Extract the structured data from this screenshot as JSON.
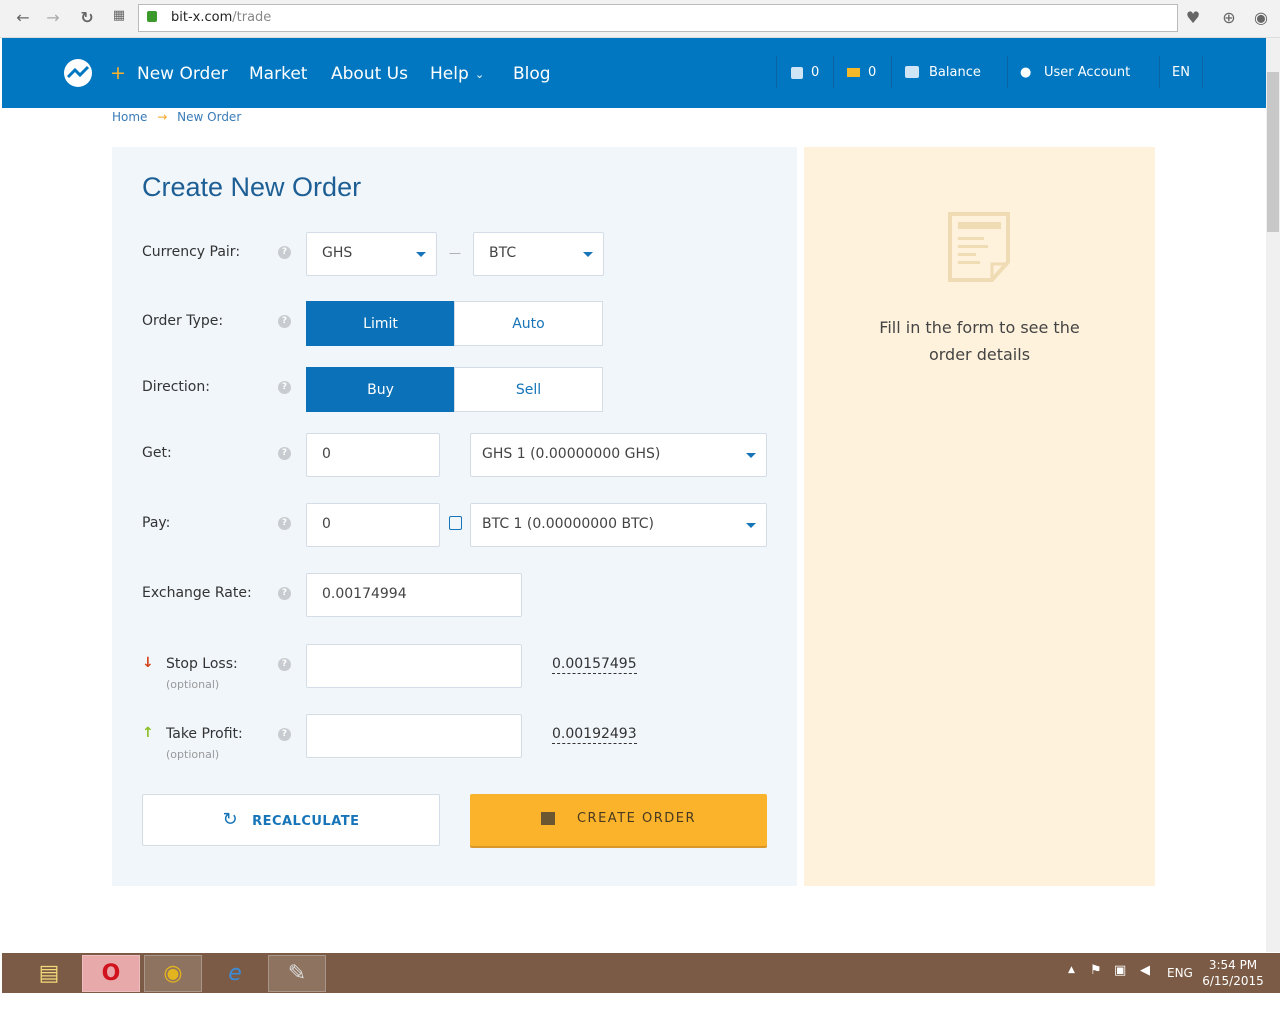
{
  "browser": {
    "url_host": "bit-x.com",
    "url_path": "/trade"
  },
  "nav": {
    "new_order": "New Order",
    "market": "Market",
    "about": "About Us",
    "help": "Help",
    "blog": "Blog",
    "transfers_count": "0",
    "messages_count": "0",
    "balance": "Balance",
    "account": "User Account",
    "lang": "EN"
  },
  "breadcrumb": {
    "home": "Home",
    "arrow": "→",
    "current": "New Order"
  },
  "form": {
    "title": "Create New Order",
    "currency_pair_label": "Currency Pair:",
    "base": "GHS",
    "dash": "—",
    "quote": "BTC",
    "order_type_label": "Order Type:",
    "limit": "Limit",
    "auto": "Auto",
    "direction_label": "Direction:",
    "buy": "Buy",
    "sell": "Sell",
    "get_label": "Get:",
    "get_value": "0",
    "get_account": "GHS 1 (0.00000000 GHS)",
    "pay_label": "Pay:",
    "pay_value": "0",
    "pay_account": "BTC 1 (0.00000000 BTC)",
    "rate_label": "Exchange Rate:",
    "rate_value": "0.00174994",
    "stop_loss_label": "Stop Loss:",
    "take_profit_label": "Take Profit:",
    "optional": "(optional)",
    "stop_loss_suggest": "0.00157495",
    "take_profit_suggest": "0.00192493",
    "recalculate": "RECALCULATE",
    "create": "CREATE ORDER"
  },
  "side": {
    "line1": "Fill in the form to see the",
    "line2": "order details"
  },
  "taskbar": {
    "lang": "ENG",
    "time": "3:54 PM",
    "date": "6/15/2015"
  },
  "colors": {
    "brand": "#0077c0",
    "accent": "#fbb32c"
  }
}
